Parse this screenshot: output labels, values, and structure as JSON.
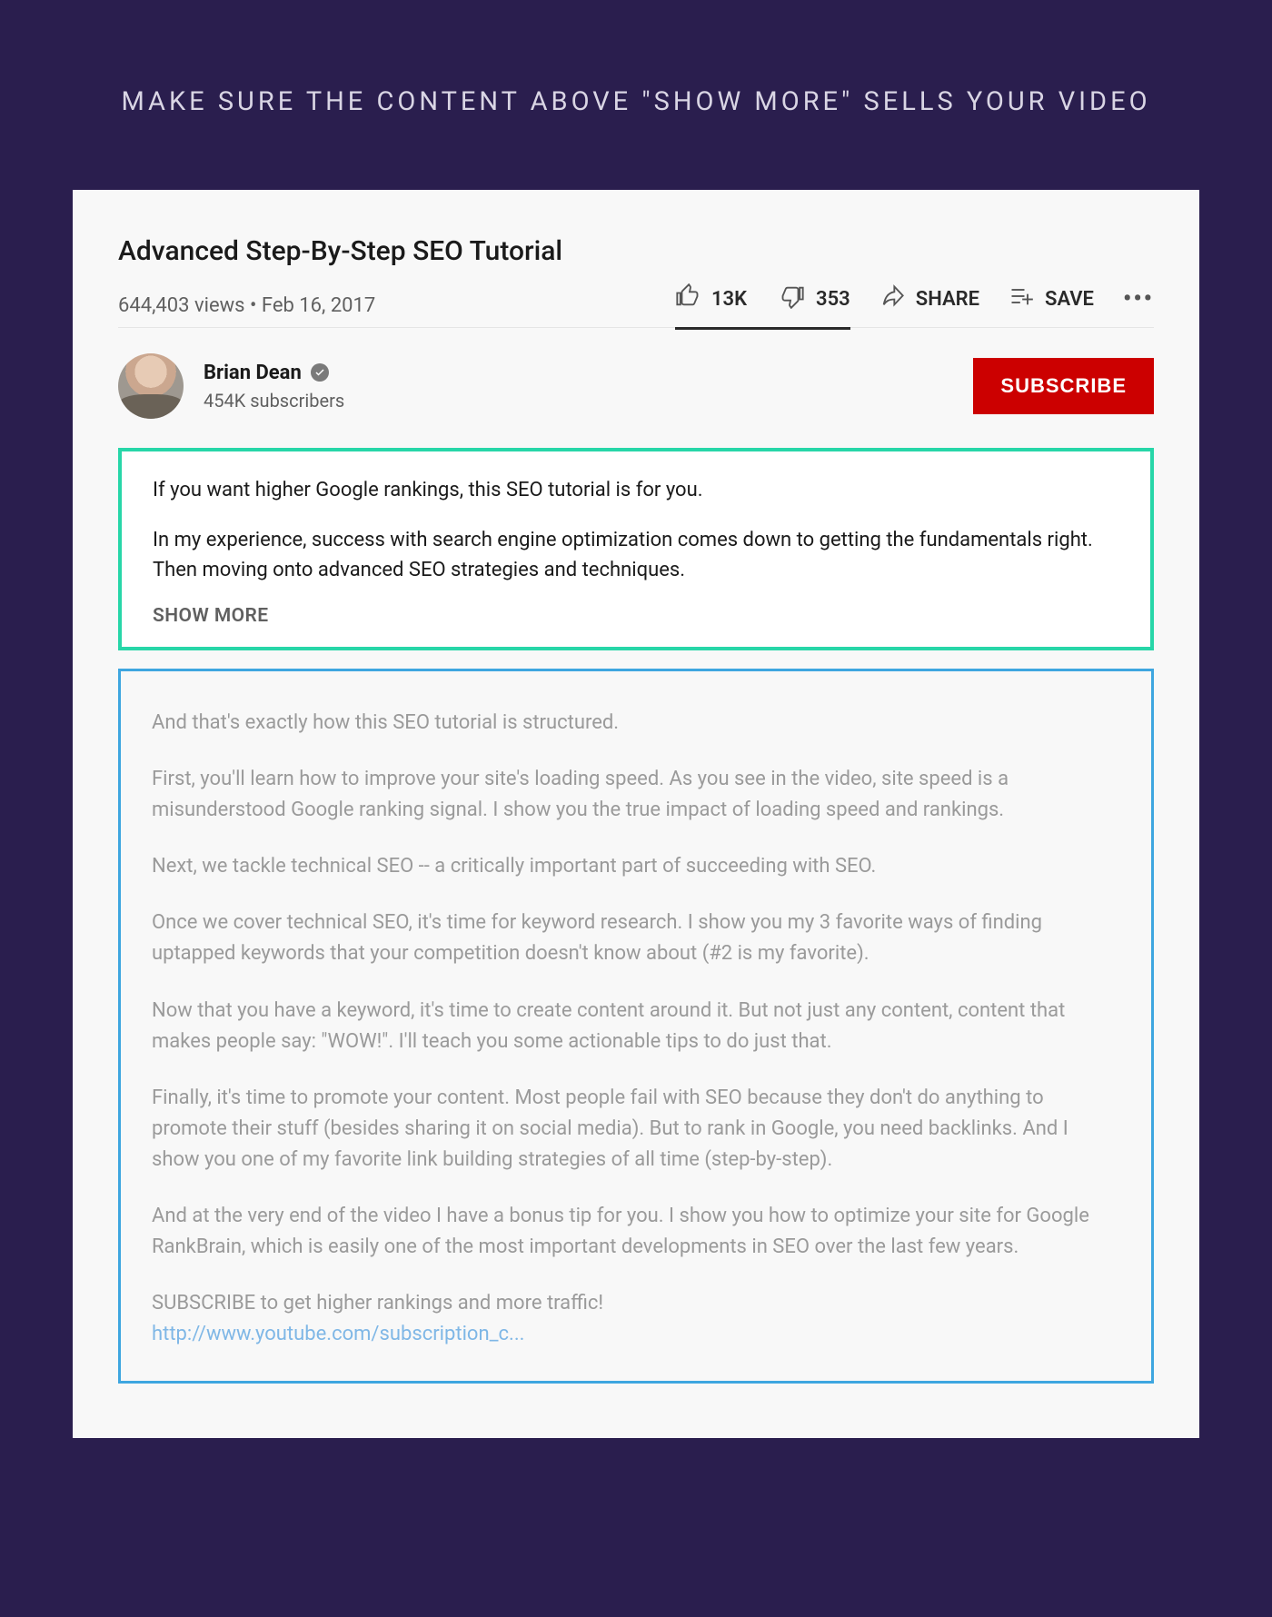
{
  "headline": "MAKE SURE THE CONTENT ABOVE \"SHOW MORE\" SELLS YOUR VIDEO",
  "video": {
    "title": "Advanced Step-By-Step SEO Tutorial",
    "views": "644,403 views",
    "date": "Feb 16, 2017",
    "likes": "13K",
    "dislikes": "353",
    "share_label": "SHARE",
    "save_label": "SAVE"
  },
  "channel": {
    "name": "Brian Dean",
    "subscribers": "454K subscribers",
    "subscribe_label": "SUBSCRIBE"
  },
  "description_above": {
    "para1": "If you want higher Google rankings, this SEO tutorial is for you.",
    "para2": "In my experience, success with search engine optimization comes down to getting the fundamentals right. Then moving onto advanced SEO strategies and techniques.",
    "show_more": "SHOW MORE"
  },
  "description_below": {
    "p1": "And that's exactly how this SEO tutorial is structured.",
    "p2": "First, you'll learn how to improve your site's loading speed. As you see in the video, site speed is a misunderstood Google ranking signal. I show you the true impact of loading speed and rankings.",
    "p3": "Next, we tackle technical SEO -- a critically important part of succeeding with SEO.",
    "p4": "Once we cover technical SEO, it's time for keyword research. I show you my 3 favorite ways of finding uptapped keywords that your competition doesn't know about (#2 is my favorite).",
    "p5": "Now that you have a keyword, it's time to create content around it. But not just any content, content that makes people say: \"WOW!\". I'll teach you some actionable tips to do just that.",
    "p6": "Finally, it's time to promote your content. Most people fail with SEO because they don't do anything to promote their stuff (besides sharing it on social media). But to rank in Google, you need backlinks. And I show you one of my favorite link building strategies of all time (step-by-step).",
    "p7": "And at the very end of the video I have a bonus tip for you. I show you how to optimize your site for Google RankBrain, which is easily one of the most important developments in SEO over the last few years.",
    "p8": "SUBSCRIBE to get higher rankings and more traffic!",
    "link": "http://www.youtube.com/subscription_c..."
  },
  "colors": {
    "background": "#2a1e4e",
    "highlight_above": "#27d6a8",
    "highlight_below": "#3ea6e0",
    "subscribe": "#cc0000"
  }
}
